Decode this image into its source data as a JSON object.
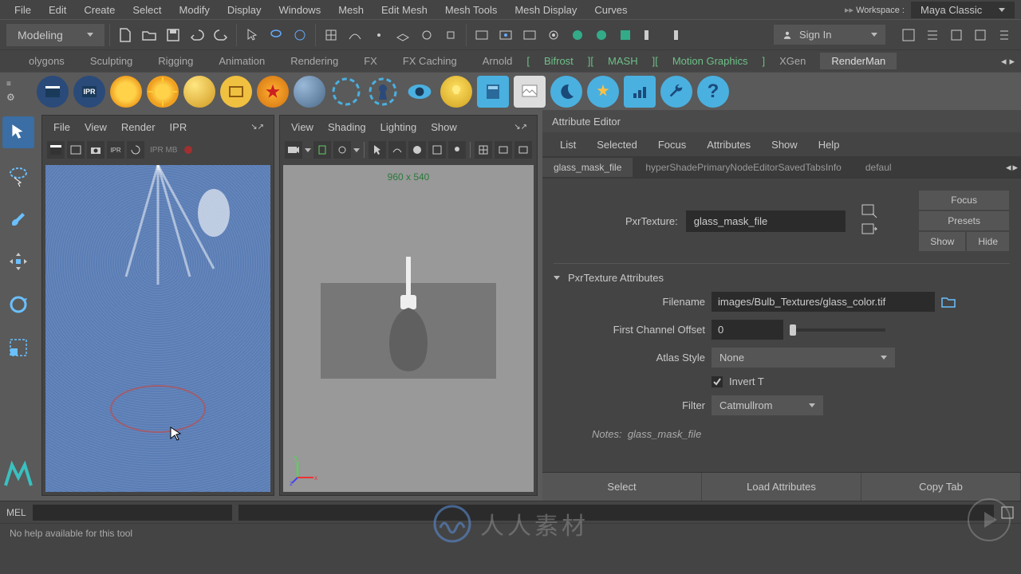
{
  "menubar": [
    "File",
    "Edit",
    "Create",
    "Select",
    "Modify",
    "Display",
    "Windows",
    "Mesh",
    "Edit Mesh",
    "Mesh Tools",
    "Mesh Display",
    "Curves"
  ],
  "workspace_label": "Workspace :",
  "workspace_value": "Maya Classic",
  "mode": "Modeling",
  "signin": "Sign In",
  "shelf_tabs": {
    "items": [
      "olygons",
      "Sculpting",
      "Rigging",
      "Animation",
      "Rendering",
      "FX",
      "FX Caching",
      "Arnold"
    ],
    "green": [
      "Bifrost",
      "MASH",
      "Motion Graphics"
    ],
    "more": [
      "XGen"
    ],
    "active": "RenderMan"
  },
  "render_panel": {
    "menus": [
      "File",
      "View",
      "Render",
      "IPR"
    ],
    "badge": "IPR   MB"
  },
  "viewport_panel": {
    "menus": [
      "View",
      "Shading",
      "Lighting",
      "Show"
    ],
    "dim": "960 x 540"
  },
  "attr": {
    "title": "Attribute Editor",
    "menus": [
      "List",
      "Selected",
      "Focus",
      "Attributes",
      "Show",
      "Help"
    ],
    "tabs": [
      "glass_mask_file",
      "hyperShadePrimaryNodeEditorSavedTabsInfo",
      "defaul"
    ],
    "node_type": "PxrTexture:",
    "node_name": "glass_mask_file",
    "btn_focus": "Focus",
    "btn_presets": "Presets",
    "btn_show": "Show",
    "btn_hide": "Hide",
    "section": "PxrTexture Attributes",
    "filename_label": "Filename",
    "filename": "images/Bulb_Textures/glass_color.tif",
    "offset_label": "First Channel Offset",
    "offset": "0",
    "atlas_label": "Atlas Style",
    "atlas": "None",
    "invert_label": "Invert T",
    "invert": true,
    "filter_label": "Filter",
    "filter": "Catmullrom",
    "notes_label": "Notes:",
    "notes_name": "glass_mask_file",
    "btn_select": "Select",
    "btn_load": "Load Attributes",
    "btn_copy": "Copy Tab"
  },
  "mel": "MEL",
  "help": "No help available for this tool",
  "watermark": "人人素材"
}
